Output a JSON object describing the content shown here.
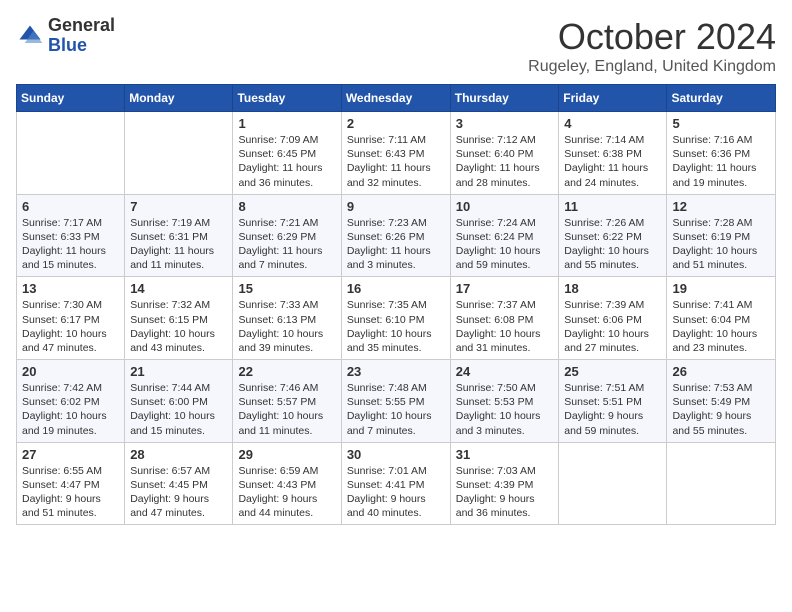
{
  "header": {
    "logo_general": "General",
    "logo_blue": "Blue",
    "month_title": "October 2024",
    "location": "Rugeley, England, United Kingdom"
  },
  "days_of_week": [
    "Sunday",
    "Monday",
    "Tuesday",
    "Wednesday",
    "Thursday",
    "Friday",
    "Saturday"
  ],
  "weeks": [
    [
      {
        "day": "",
        "info": ""
      },
      {
        "day": "",
        "info": ""
      },
      {
        "day": "1",
        "info": "Sunrise: 7:09 AM\nSunset: 6:45 PM\nDaylight: 11 hours and 36 minutes."
      },
      {
        "day": "2",
        "info": "Sunrise: 7:11 AM\nSunset: 6:43 PM\nDaylight: 11 hours and 32 minutes."
      },
      {
        "day": "3",
        "info": "Sunrise: 7:12 AM\nSunset: 6:40 PM\nDaylight: 11 hours and 28 minutes."
      },
      {
        "day": "4",
        "info": "Sunrise: 7:14 AM\nSunset: 6:38 PM\nDaylight: 11 hours and 24 minutes."
      },
      {
        "day": "5",
        "info": "Sunrise: 7:16 AM\nSunset: 6:36 PM\nDaylight: 11 hours and 19 minutes."
      }
    ],
    [
      {
        "day": "6",
        "info": "Sunrise: 7:17 AM\nSunset: 6:33 PM\nDaylight: 11 hours and 15 minutes."
      },
      {
        "day": "7",
        "info": "Sunrise: 7:19 AM\nSunset: 6:31 PM\nDaylight: 11 hours and 11 minutes."
      },
      {
        "day": "8",
        "info": "Sunrise: 7:21 AM\nSunset: 6:29 PM\nDaylight: 11 hours and 7 minutes."
      },
      {
        "day": "9",
        "info": "Sunrise: 7:23 AM\nSunset: 6:26 PM\nDaylight: 11 hours and 3 minutes."
      },
      {
        "day": "10",
        "info": "Sunrise: 7:24 AM\nSunset: 6:24 PM\nDaylight: 10 hours and 59 minutes."
      },
      {
        "day": "11",
        "info": "Sunrise: 7:26 AM\nSunset: 6:22 PM\nDaylight: 10 hours and 55 minutes."
      },
      {
        "day": "12",
        "info": "Sunrise: 7:28 AM\nSunset: 6:19 PM\nDaylight: 10 hours and 51 minutes."
      }
    ],
    [
      {
        "day": "13",
        "info": "Sunrise: 7:30 AM\nSunset: 6:17 PM\nDaylight: 10 hours and 47 minutes."
      },
      {
        "day": "14",
        "info": "Sunrise: 7:32 AM\nSunset: 6:15 PM\nDaylight: 10 hours and 43 minutes."
      },
      {
        "day": "15",
        "info": "Sunrise: 7:33 AM\nSunset: 6:13 PM\nDaylight: 10 hours and 39 minutes."
      },
      {
        "day": "16",
        "info": "Sunrise: 7:35 AM\nSunset: 6:10 PM\nDaylight: 10 hours and 35 minutes."
      },
      {
        "day": "17",
        "info": "Sunrise: 7:37 AM\nSunset: 6:08 PM\nDaylight: 10 hours and 31 minutes."
      },
      {
        "day": "18",
        "info": "Sunrise: 7:39 AM\nSunset: 6:06 PM\nDaylight: 10 hours and 27 minutes."
      },
      {
        "day": "19",
        "info": "Sunrise: 7:41 AM\nSunset: 6:04 PM\nDaylight: 10 hours and 23 minutes."
      }
    ],
    [
      {
        "day": "20",
        "info": "Sunrise: 7:42 AM\nSunset: 6:02 PM\nDaylight: 10 hours and 19 minutes."
      },
      {
        "day": "21",
        "info": "Sunrise: 7:44 AM\nSunset: 6:00 PM\nDaylight: 10 hours and 15 minutes."
      },
      {
        "day": "22",
        "info": "Sunrise: 7:46 AM\nSunset: 5:57 PM\nDaylight: 10 hours and 11 minutes."
      },
      {
        "day": "23",
        "info": "Sunrise: 7:48 AM\nSunset: 5:55 PM\nDaylight: 10 hours and 7 minutes."
      },
      {
        "day": "24",
        "info": "Sunrise: 7:50 AM\nSunset: 5:53 PM\nDaylight: 10 hours and 3 minutes."
      },
      {
        "day": "25",
        "info": "Sunrise: 7:51 AM\nSunset: 5:51 PM\nDaylight: 9 hours and 59 minutes."
      },
      {
        "day": "26",
        "info": "Sunrise: 7:53 AM\nSunset: 5:49 PM\nDaylight: 9 hours and 55 minutes."
      }
    ],
    [
      {
        "day": "27",
        "info": "Sunrise: 6:55 AM\nSunset: 4:47 PM\nDaylight: 9 hours and 51 minutes."
      },
      {
        "day": "28",
        "info": "Sunrise: 6:57 AM\nSunset: 4:45 PM\nDaylight: 9 hours and 47 minutes."
      },
      {
        "day": "29",
        "info": "Sunrise: 6:59 AM\nSunset: 4:43 PM\nDaylight: 9 hours and 44 minutes."
      },
      {
        "day": "30",
        "info": "Sunrise: 7:01 AM\nSunset: 4:41 PM\nDaylight: 9 hours and 40 minutes."
      },
      {
        "day": "31",
        "info": "Sunrise: 7:03 AM\nSunset: 4:39 PM\nDaylight: 9 hours and 36 minutes."
      },
      {
        "day": "",
        "info": ""
      },
      {
        "day": "",
        "info": ""
      }
    ]
  ]
}
